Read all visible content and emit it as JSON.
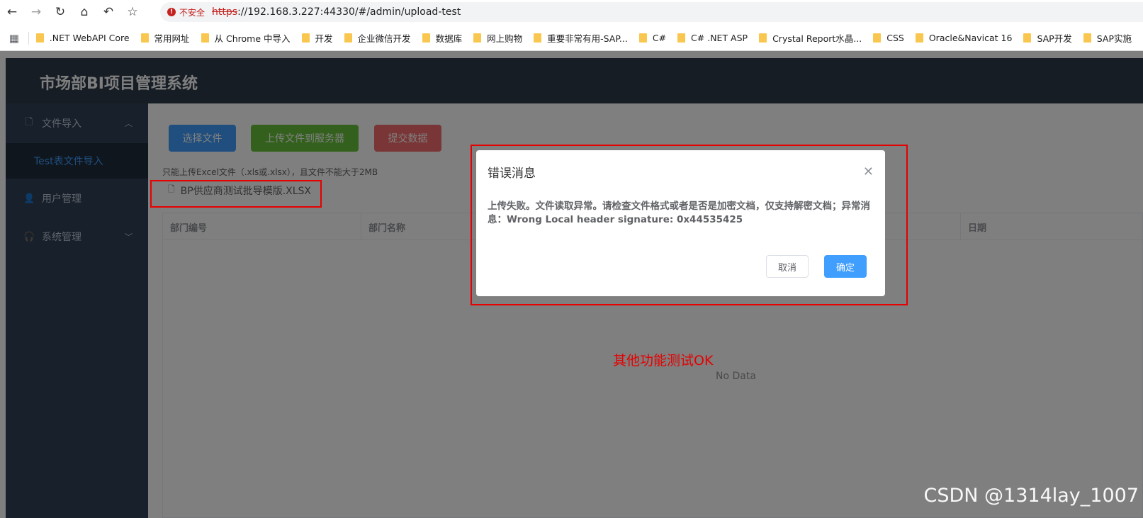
{
  "browser": {
    "insecure_label": "不安全",
    "url_scheme": "https",
    "url_rest": "://192.168.3.227:44330/#/admin/upload-test",
    "bookmarks": [
      ".NET WebAPI Core",
      "常用网址",
      "从 Chrome 中导入",
      "开发",
      "企业微信开发",
      "数据库",
      "网上购物",
      "重要非常有用-SAP...",
      "C#",
      "C# .NET ASP",
      "Crystal Report水晶...",
      "CSS",
      "Oracle&Navicat 16",
      "SAP开发",
      "SAP实施"
    ]
  },
  "header": {
    "title": "市场部BI项目管理系统"
  },
  "sidebar": {
    "items": [
      {
        "label": "文件导入",
        "icon": "document-icon"
      },
      {
        "label": "用户管理",
        "icon": "user-icon"
      },
      {
        "label": "系统管理",
        "icon": "headset-icon"
      }
    ],
    "sub_item": "Test表文件导入"
  },
  "toolbar": {
    "choose_file": "选择文件",
    "upload_to_server": "上传文件到服务器",
    "submit_data": "提交数据",
    "hint": "只能上传Excel文件（.xls或.xlsx），且文件不能大于2MB",
    "file_name": "BP供应商测试批导模版.XLSX"
  },
  "table": {
    "columns": [
      "部门编号",
      "部门名称",
      "日期"
    ],
    "empty_text": "No Data"
  },
  "dialog": {
    "title": "错误消息",
    "message": "上传失败。文件读取异常。请检查文件格式或者是否是加密文档，仅支持解密文档；异常消息：Wrong Local header signature: 0x44535425",
    "cancel": "取消",
    "confirm": "确定"
  },
  "annotation": {
    "note": "其他功能测试OK"
  },
  "watermark": "CSDN @1314lay_1007",
  "colors": {
    "primary": "#409eff",
    "success": "#67c23a",
    "danger": "#f56c6c",
    "sidebar": "#304156",
    "header": "#2d3a4b",
    "annotation": "#e60000"
  }
}
